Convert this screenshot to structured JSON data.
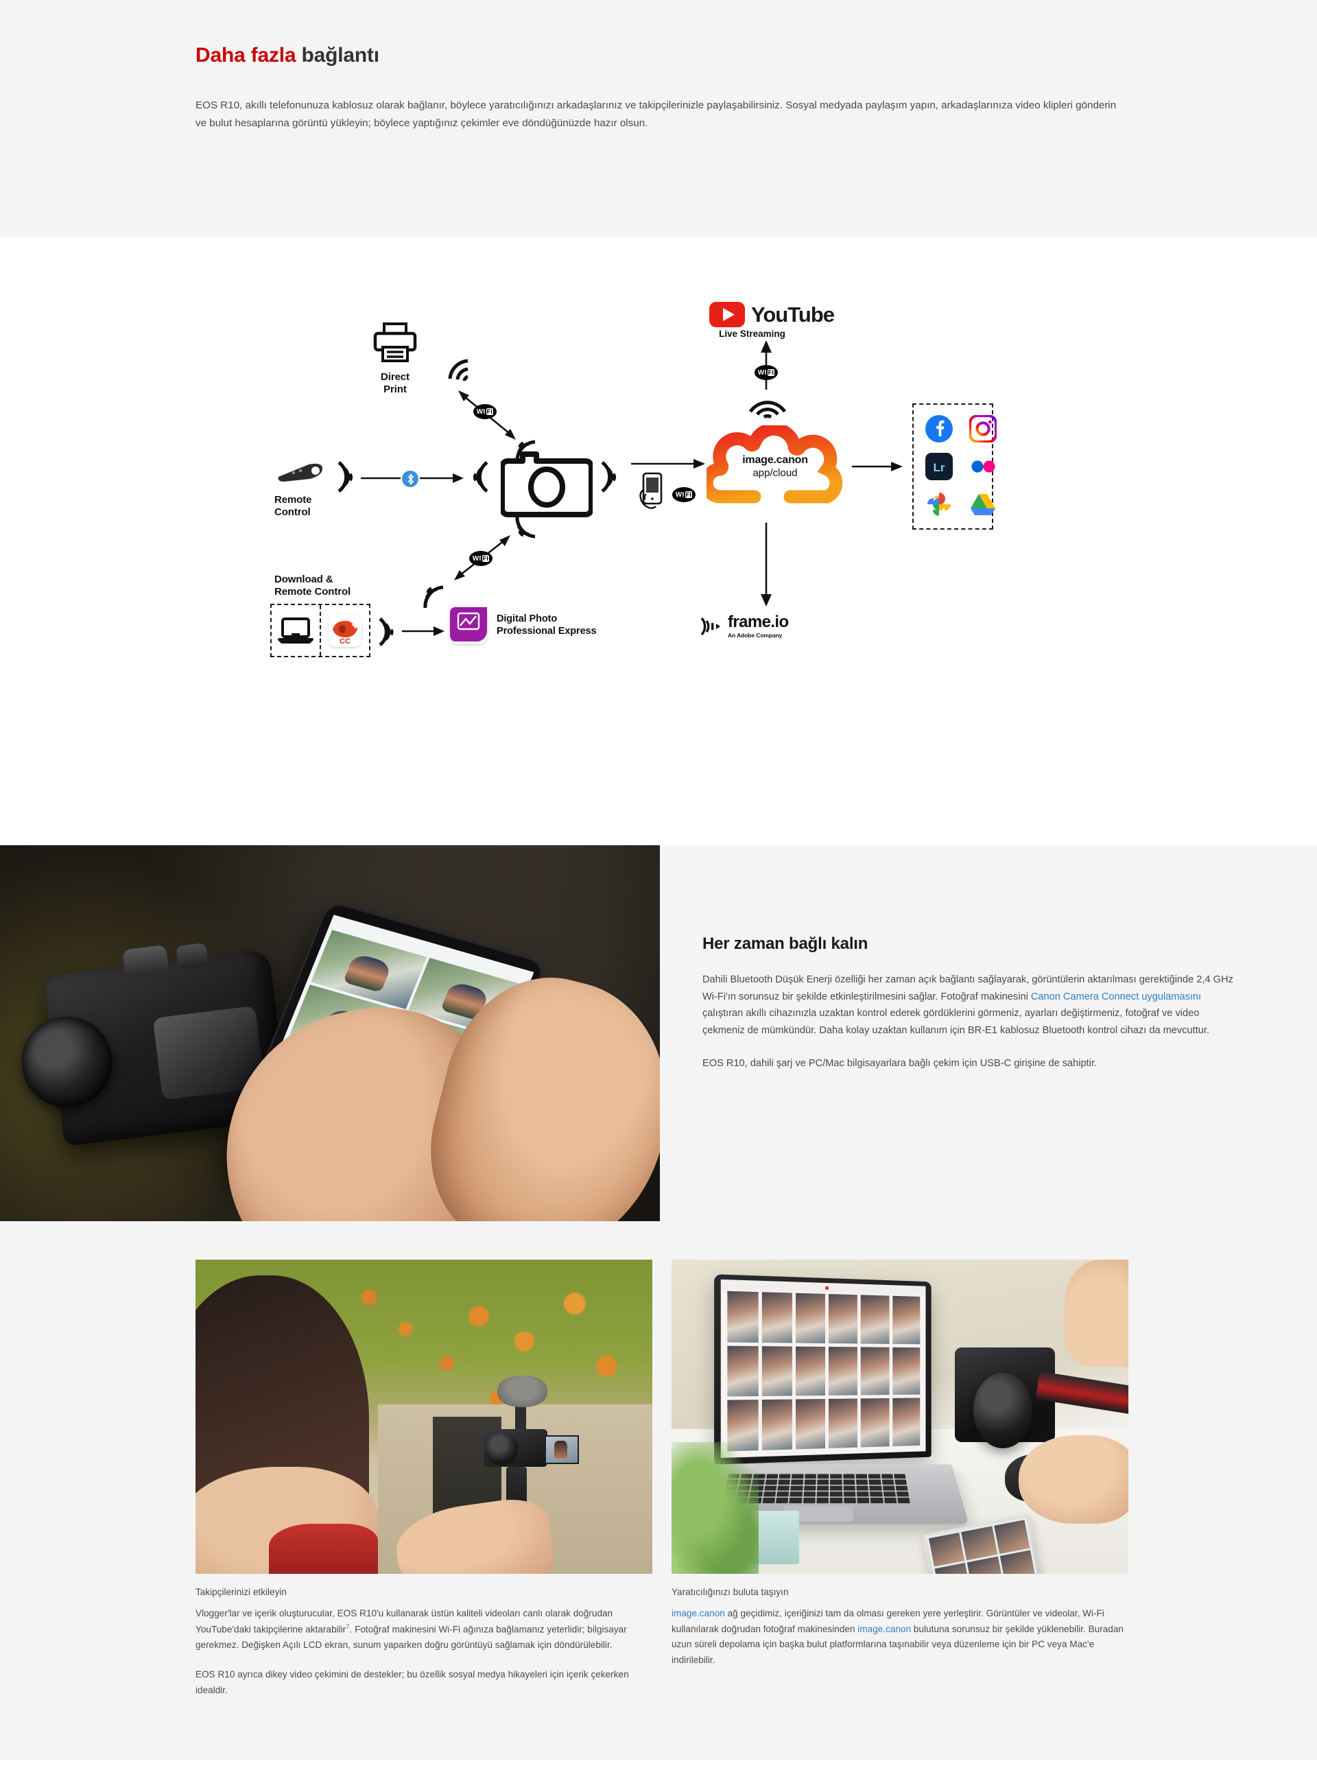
{
  "intro": {
    "title_red": "Daha fazla",
    "title_dark": "bağlantı",
    "body": "EOS R10, akıllı telefonunuza kablosuz olarak bağlanır, böylece yaratıcılığınızı arkadaşlarınız ve takipçilerinizle paylaşabilirsiniz. Sosyal medyada paylaşım yapın, arkadaşlarınıza video klipleri gönderin ve bulut hesaplarına görüntü yükleyin; böylece yaptığınız çekimler eve döndüğünüzde hazır olsun."
  },
  "diagram": {
    "direct_print": "Direct\nPrint",
    "direct_print_l1": "Direct",
    "direct_print_l2": "Print",
    "remote_control_l1": "Remote",
    "remote_control_l2": "Control",
    "download_l1": "Download &",
    "download_l2": "Remote Control",
    "youtube_brand": "YouTube",
    "youtube_sub": "Live Streaming",
    "cloud_l1": "image.canon",
    "cloud_l2": "app/cloud",
    "dppe_badge": "DPPE",
    "dppe_l1": "Digital Photo",
    "dppe_l2": "Professional Express",
    "frameio_name": "frame.io",
    "frameio_sub": "An Adobe Company",
    "cc_badge": "CC",
    "wifi_label": "WiFi",
    "wifi_label_part1": "WI",
    "wifi_label_part2": "FI",
    "apps": [
      {
        "name": "facebook-icon",
        "label": "Facebook"
      },
      {
        "name": "instagram-icon",
        "label": "Instagram"
      },
      {
        "name": "lightroom-icon",
        "label": "Lr"
      },
      {
        "name": "flickr-icon",
        "label": "Flickr"
      },
      {
        "name": "google-photos-icon",
        "label": "Google Photos"
      },
      {
        "name": "google-drive-icon",
        "label": "Google Drive"
      }
    ]
  },
  "split": {
    "heading": "Her zaman bağlı kalın",
    "p1_a": "Dahili Bluetooth Düşük Enerji özelliği her zaman açık bağlantı sağlayarak, görüntülerin aktarılması gerektiğinde 2,4 GHz Wi-Fi'ın sorunsuz bir şekilde etkinleştirilmesini sağlar. Fotoğraf makinesini ",
    "p1_link": "Canon Camera Connect uygulamasını",
    "p1_b": " çalıştıran akıllı cihazınızla uzaktan kontrol ederek gördüklerini görmeniz, ayarları değiştirmeniz, fotoğraf ve video çekmeniz de mümkündür. Daha kolay uzaktan kullanım için BR-E1 kablosuz Bluetooth kontrol cihazı da mevcuttur.",
    "p2": "EOS R10, dahili şarj ve PC/Mac bilgisayarlara bağlı çekim için USB-C girişine de sahiptir."
  },
  "cards": [
    {
      "caption": "Takipçilerinizi etkileyin",
      "body1_a": "Vlogger'lar ve içerik oluşturucular, EOS R10'u kullanarak üstün kaliteli videoları canlı olarak doğrudan YouTube'daki takipçilerine aktarabilir",
      "body1_sup": "7",
      "body1_b": ". Fotoğraf makinesini Wi-Fi ağınıza bağlamanız yeterlidir; bilgisayar gerekmez. Değişken Açılı LCD ekran, sunum yaparken doğru görüntüyü sağlamak için döndürülebilir.",
      "body2": "EOS R10 ayrıca dikey video çekimini de destekler; bu özellik sosyal medya hikayeleri için içerik çekerken idealdir."
    },
    {
      "caption": "Yaratıcılığınızı buluta taşıyın",
      "body1_link1": "image.canon",
      "body1_a": " ağ geçidimiz, içeriğinizi tam da olması gereken yere yerleştirir. Görüntüler ve videolar, Wi-Fi kullanılarak doğrudan fotoğraf makinesinden ",
      "body1_link2": "image.canon",
      "body1_b": " bulutuna sorunsuz bir şekilde yüklenebilir. Buradan uzun süreli depolama için başka bulut platformlarına taşınabilir veya düzenleme için bir PC veya Mac'e indirilebilir."
    }
  ],
  "colors": {
    "accent_red": "#cc0000",
    "link_blue": "#2f7fc1",
    "bg_gray": "#f4f4f4",
    "cloud_red": "#e8201f",
    "cloud_orange": "#f08a1c",
    "bluetooth_blue": "#3d8fd6",
    "dppe_purple": "#9b1ba3"
  }
}
